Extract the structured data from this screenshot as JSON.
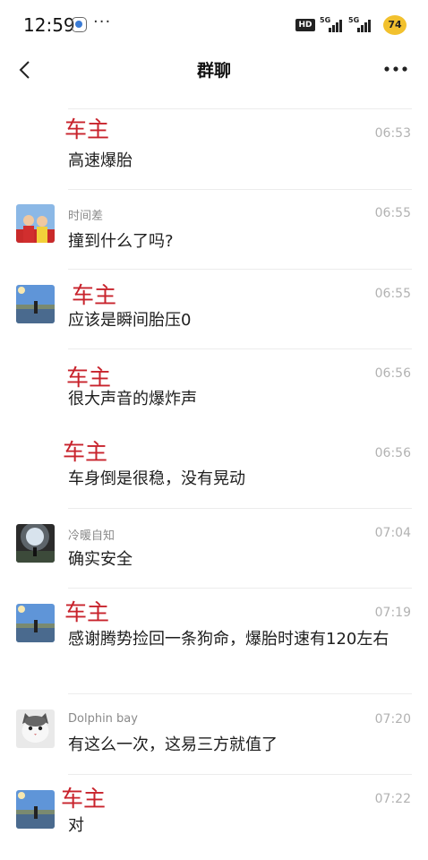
{
  "status_bar": {
    "time": "12:59",
    "more": "···",
    "hd_label": "HD",
    "net1": "5G",
    "net2": "5G",
    "battery": "74"
  },
  "header": {
    "title": "群聊"
  },
  "messages": [
    {
      "sender": "车主",
      "time": "06:53",
      "text": "高速爆胎"
    },
    {
      "sender": "时间差",
      "time": "06:55",
      "text": "撞到什么了吗?"
    },
    {
      "sender": "车主",
      "time": "06:55",
      "text": "应该是瞬间胎压0"
    },
    {
      "sender": "车主",
      "time": "06:56",
      "text": "很大声音的爆炸声"
    },
    {
      "sender": "车主",
      "time": "06:56",
      "text": "车身倒是很稳，没有晃动"
    },
    {
      "sender": "冷暖自知",
      "time": "07:04",
      "text": "确实安全"
    },
    {
      "sender": "车主",
      "time": "07:19",
      "text": "感谢腾势捡回一条狗命，爆胎时速有120左右"
    },
    {
      "sender": "Dolphin bay",
      "time": "07:20",
      "text": "有这么一次，这易三方就值了"
    },
    {
      "sender": "车主",
      "time": "07:22",
      "text": "对"
    }
  ],
  "colors": {
    "owner_name": "#c8232c",
    "meta_gray": "#b2b2b2",
    "battery": "#f2c12e"
  }
}
